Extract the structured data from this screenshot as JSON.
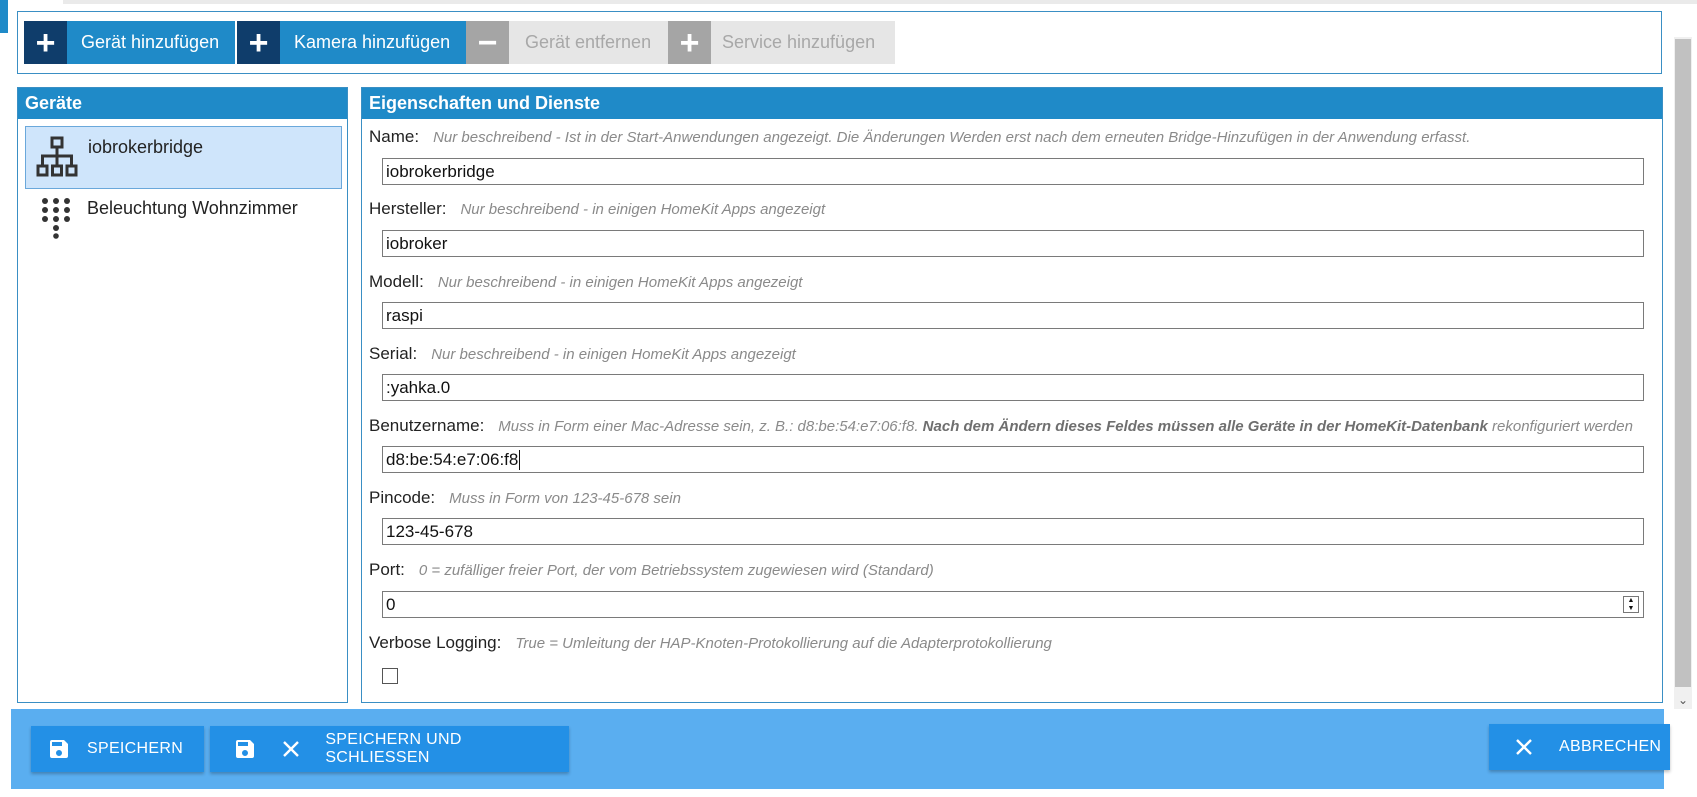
{
  "toolbar": {
    "add_device": "Gerät hinzufügen",
    "add_camera": "Kamera hinzufügen",
    "remove_device": "Gerät entfernen",
    "add_service": "Service hinzufügen"
  },
  "devices_panel": {
    "title": "Geräte",
    "items": [
      {
        "name": "iobrokerbridge",
        "icon": "bridge-hierarchy-icon",
        "selected": true
      },
      {
        "name": "Beleuchtung Wohnzimmer",
        "icon": "keypad-dots-icon",
        "selected": false
      }
    ]
  },
  "properties_panel": {
    "title": "Eigenschaften und Dienste",
    "fields": {
      "name": {
        "label": "Name:",
        "hint": "Nur beschreibend - Ist in der Start-Anwendungen angezeigt. Die Änderungen Werden erst nach dem erneuten Bridge-Hinzufügen in der Anwendung erfasst.",
        "value": "iobrokerbridge"
      },
      "manufacturer": {
        "label": "Hersteller:",
        "hint": "Nur beschreibend - in einigen HomeKit Apps angezeigt",
        "value": "iobroker"
      },
      "model": {
        "label": "Modell:",
        "hint": "Nur beschreibend - in einigen HomeKit Apps angezeigt",
        "value": "raspi"
      },
      "serial": {
        "label": "Serial:",
        "hint": "Nur beschreibend - in einigen HomeKit Apps angezeigt",
        "value": ":yahka.0"
      },
      "username": {
        "label": "Benutzername:",
        "hint_pre": "Muss in Form einer Mac-Adresse sein, z. B.: d8:be:54:e7:06:f8.",
        "hint_bold": "Nach dem Ändern dieses Feldes müssen alle Geräte in der HomeKit-Datenbank",
        "hint_post": "rekonfiguriert werden",
        "value": "d8:be:54:e7:06:f8"
      },
      "pincode": {
        "label": "Pincode:",
        "hint": "Muss in Form von 123-45-678 sein",
        "value": "123-45-678"
      },
      "port": {
        "label": "Port:",
        "hint": "0 = zufälliger freier Port, der vom Betriebssystem zugewiesen wird (Standard)",
        "value": "0"
      },
      "verbose": {
        "label": "Verbose Logging:",
        "hint": "True = Umleitung der HAP-Knoten-Protokollierung auf die Adapterprotokollierung",
        "checked": false
      }
    }
  },
  "footer": {
    "save": "SPEICHERN",
    "save_close": "SPEICHERN UND SCHLIESSEN",
    "cancel": "ABBRECHEN"
  },
  "colors": {
    "accent": "#1f8ac8",
    "toolbar_icon_dark": "#0f3d6b",
    "footer_bar": "#5aaef0",
    "footer_button": "#2390e6",
    "selection": "#cfe5fb"
  }
}
